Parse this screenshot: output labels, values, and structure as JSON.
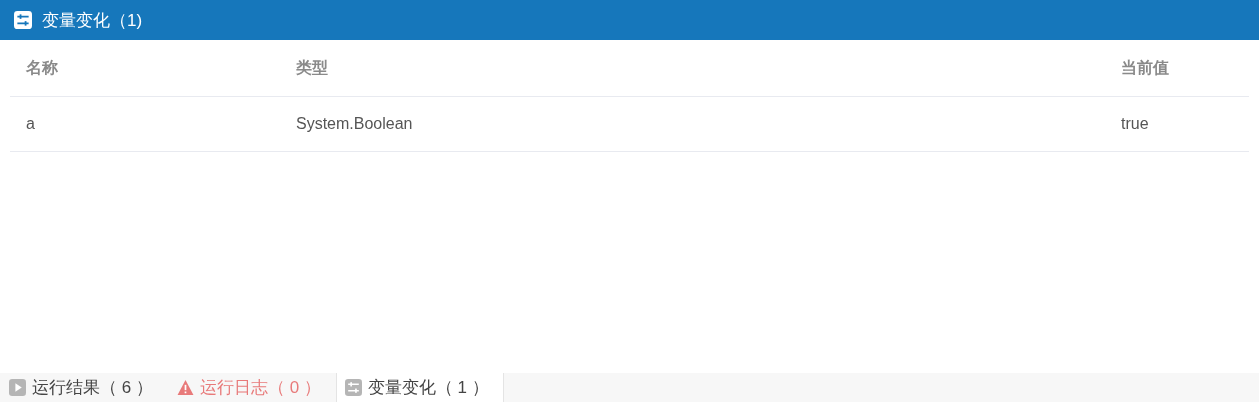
{
  "panel": {
    "title": "变量变化（1)"
  },
  "table": {
    "columns": [
      "名称",
      "类型",
      "当前值"
    ],
    "rows": [
      [
        "a",
        "System.Boolean",
        "true"
      ]
    ]
  },
  "tabs": [
    {
      "kind": "result",
      "label": "运行结果（ 6 ）",
      "selected": false
    },
    {
      "kind": "log",
      "label": "运行日志（ 0 ）",
      "selected": false
    },
    {
      "kind": "variables",
      "label": "变量变化（ 1 ）",
      "selected": true
    }
  ]
}
